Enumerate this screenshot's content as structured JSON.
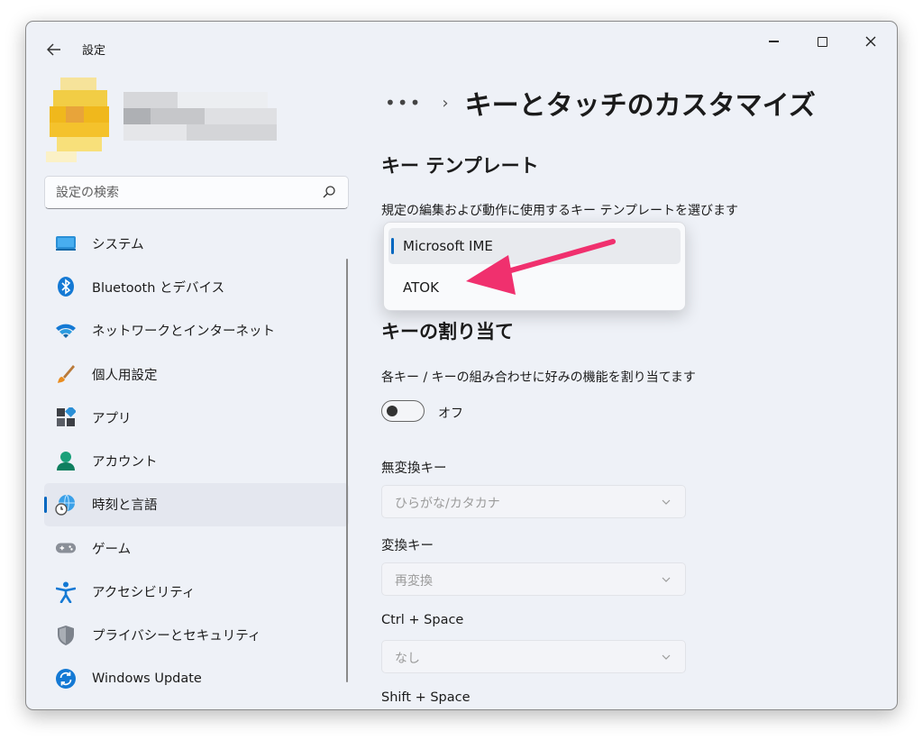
{
  "window": {
    "title": "設定",
    "back_icon": "back-arrow-icon",
    "controls": [
      "minimize-icon",
      "maximize-icon",
      "close-icon"
    ]
  },
  "search": {
    "placeholder": "設定の検索",
    "icon": "search-icon"
  },
  "sidebar": {
    "items": [
      {
        "label": "システム",
        "icon": "system-icon",
        "active": false
      },
      {
        "label": "Bluetooth とデバイス",
        "icon": "bluetooth-icon",
        "active": false
      },
      {
        "label": "ネットワークとインターネット",
        "icon": "wifi-icon",
        "active": false
      },
      {
        "label": "個人用設定",
        "icon": "brush-icon",
        "active": false
      },
      {
        "label": "アプリ",
        "icon": "apps-icon",
        "active": false
      },
      {
        "label": "アカウント",
        "icon": "account-icon",
        "active": false
      },
      {
        "label": "時刻と言語",
        "icon": "time-language-icon",
        "active": true
      },
      {
        "label": "ゲーム",
        "icon": "gamepad-icon",
        "active": false
      },
      {
        "label": "アクセシビリティ",
        "icon": "accessibility-icon",
        "active": false
      },
      {
        "label": "プライバシーとセキュリティ",
        "icon": "shield-icon",
        "active": false
      },
      {
        "label": "Windows Update",
        "icon": "update-icon",
        "active": false
      }
    ]
  },
  "breadcrumb": {
    "more": "•••",
    "separator": "›",
    "title": "キーとタッチのカスタマイズ"
  },
  "key_template": {
    "heading": "キー テンプレート",
    "description": "規定の編集および動作に使用するキー テンプレートを選びます",
    "options": [
      "Microsoft IME",
      "ATOK"
    ],
    "selected": "Microsoft IME"
  },
  "key_assign": {
    "heading": "キーの割り当て",
    "description": "各キー / キーの組み合わせに好みの機能を割り当てます",
    "toggle_state": "オフ",
    "fields": [
      {
        "label": "無変換キー",
        "value": "ひらがな/カタカナ"
      },
      {
        "label": "変換キー",
        "value": "再変換"
      },
      {
        "label": "Ctrl + Space",
        "value": "なし"
      },
      {
        "label": "Shift + Space",
        "value": ""
      }
    ]
  },
  "colors": {
    "accent": "#0067c0",
    "annotation_arrow": "#f0306e",
    "window_bg": "#eef1f7"
  }
}
